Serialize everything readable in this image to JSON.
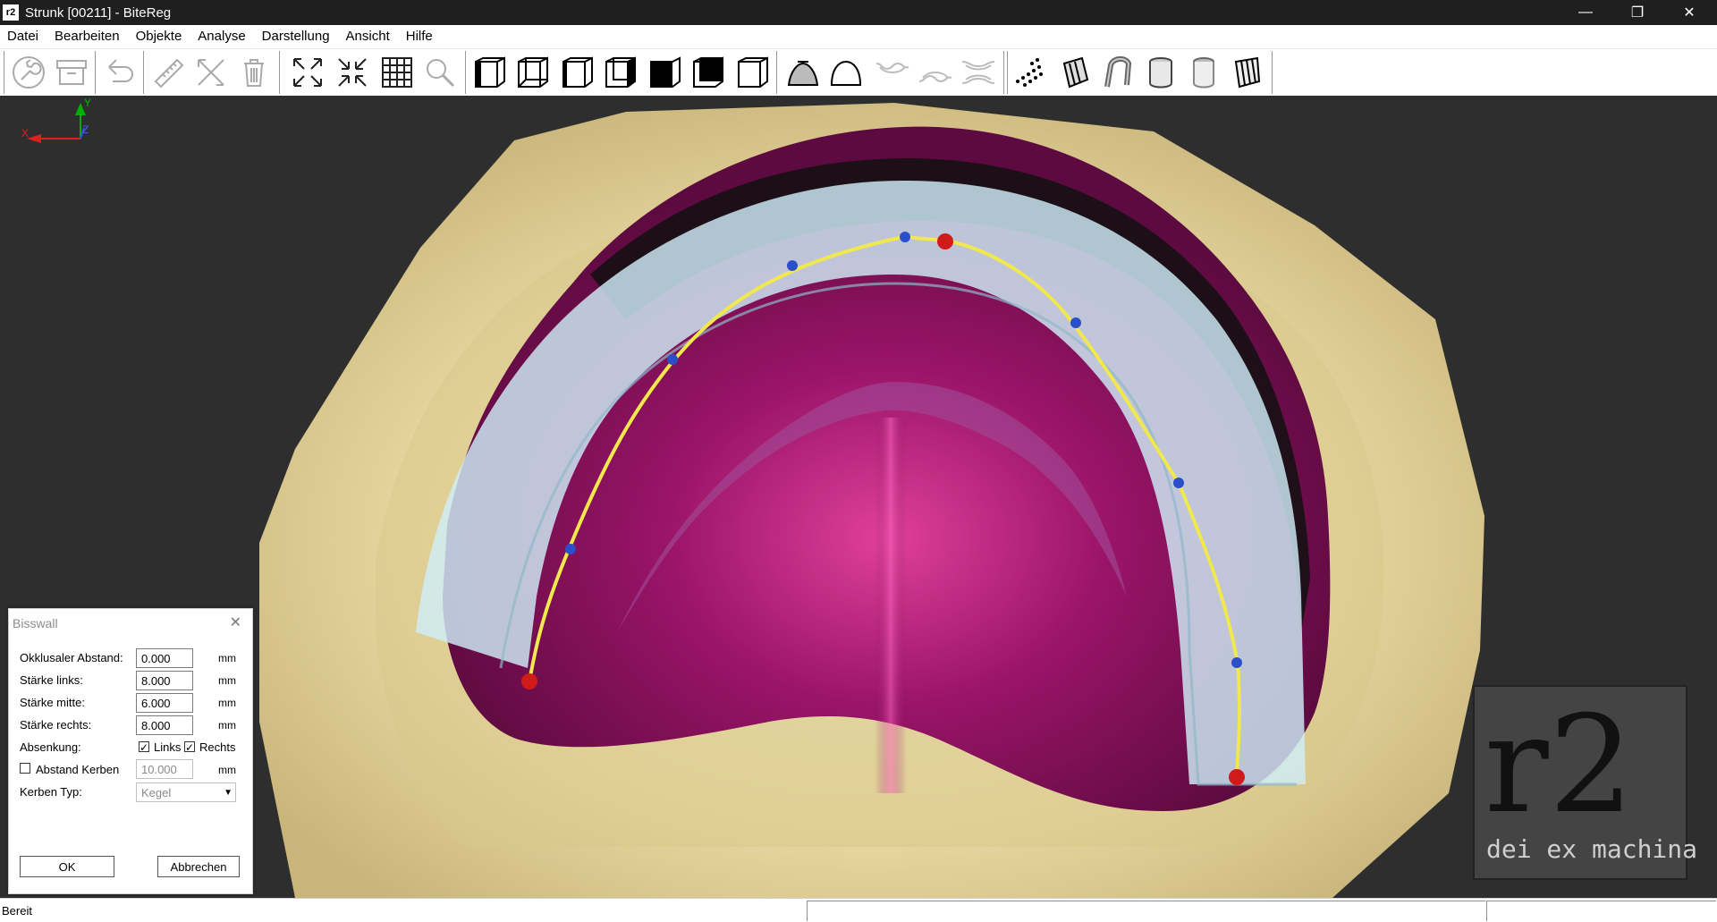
{
  "window": {
    "title": "Strunk [00211] - BiteReg",
    "app_icon_text": "r2",
    "minimize": "—",
    "maximize": "❐",
    "close": "✕"
  },
  "menu": [
    "Datei",
    "Bearbeiten",
    "Objekte",
    "Analyse",
    "Darstellung",
    "Ansicht",
    "Hilfe"
  ],
  "toolbar_icons": [
    "wrench-icon",
    "archive-icon",
    "undo-icon",
    "ruler-icon",
    "cross-tools-icon",
    "trash-icon",
    "expand-icon",
    "collapse-icon",
    "grid-icon",
    "zoom-icon",
    "view-front-icon",
    "view-back-icon",
    "view-left-icon",
    "view-right-icon",
    "view-top-icon",
    "view-bottom-icon",
    "view-iso-icon",
    "mesh-dome-icon",
    "arch-icon",
    "upper-jaw-icon",
    "lower-jaw-icon",
    "both-jaws-icon",
    "point-cloud-icon",
    "block-icon",
    "cylinder-bend-icon",
    "cylinder-icon",
    "cylinder-soft-icon",
    "cylinder-wire-icon"
  ],
  "viewport": {
    "axis_labels": {
      "x": "X",
      "y": "Y",
      "z": "Z"
    },
    "logo": {
      "main": "r2",
      "tagline": "dei ex machina"
    }
  },
  "dialog": {
    "title": "Bisswall",
    "close": "✕",
    "fields": [
      {
        "label": "Okklusaler Abstand:",
        "value": "0.000",
        "unit": "mm"
      },
      {
        "label": "Stärke links:",
        "value": "8.000",
        "unit": "mm"
      },
      {
        "label": "Stärke mitte:",
        "value": "6.000",
        "unit": "mm"
      },
      {
        "label": "Stärke rechts:",
        "value": "8.000",
        "unit": "mm"
      }
    ],
    "absenkung": {
      "label": "Absenkung:",
      "links": "Links",
      "rechts": "Rechts",
      "links_checked": true,
      "rechts_checked": true
    },
    "abstand_kerben": {
      "label": "Abstand Kerben",
      "value": "10.000",
      "unit": "mm",
      "checked": false
    },
    "kerben_typ": {
      "label": "Kerben Typ:",
      "value": "Kegel"
    },
    "ok": "OK",
    "cancel": "Abbrechen"
  },
  "status": {
    "text": "Bereit"
  },
  "colors": {
    "background": "#2e2e2e",
    "base": "#e9dba6",
    "tissue": "#8a0f5c",
    "rim": "#bfe3ef",
    "curve": "#e8e04a",
    "control_point": "#2a4fc8",
    "end_point": "#d11a1a"
  }
}
